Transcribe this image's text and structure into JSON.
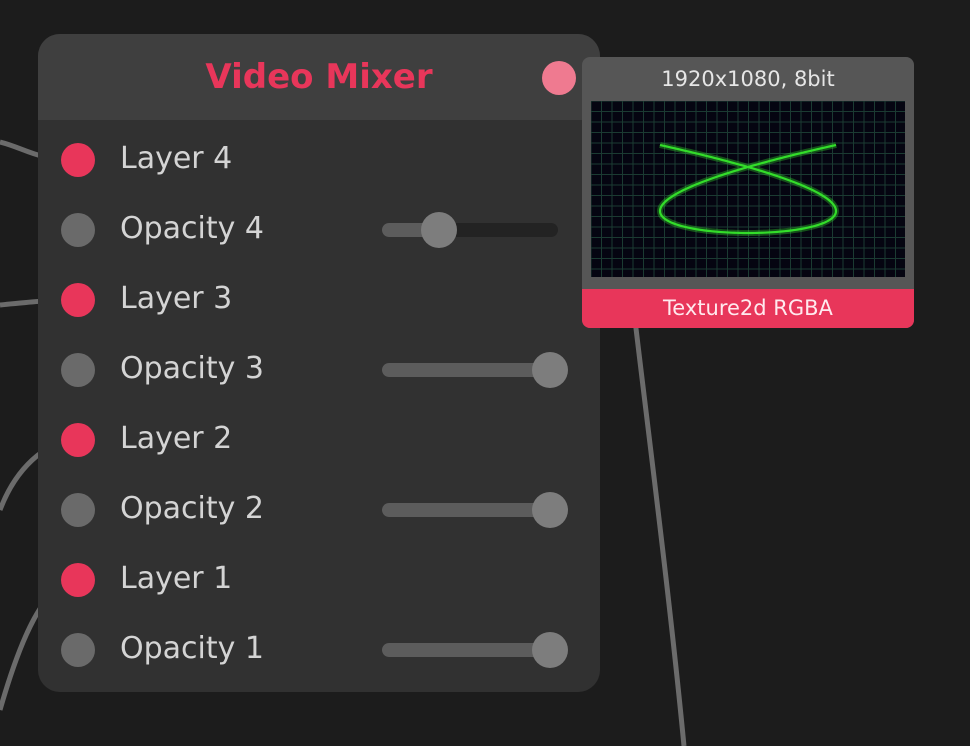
{
  "node": {
    "title": "Video Mixer",
    "rows": [
      {
        "kind": "layer",
        "label": "Layer 4"
      },
      {
        "kind": "opacity",
        "label": "Opacity 4",
        "value": 0.24
      },
      {
        "kind": "layer",
        "label": "Layer 3"
      },
      {
        "kind": "opacity",
        "label": "Opacity 3",
        "value": 1.0
      },
      {
        "kind": "layer",
        "label": "Layer 2"
      },
      {
        "kind": "opacity",
        "label": "Opacity 2",
        "value": 1.0
      },
      {
        "kind": "layer",
        "label": "Layer 1"
      },
      {
        "kind": "opacity",
        "label": "Opacity 1",
        "value": 1.0
      }
    ]
  },
  "preview": {
    "info": "1920x1080, 8bit",
    "type": "Texture2d RGBA"
  },
  "colors": {
    "accent": "#e8365a",
    "background": "#1c1c1c",
    "node_body": "#313131",
    "node_header": "#3f3f3f",
    "lissajous": "#33dd2a"
  },
  "icons": {
    "layer_port": "red-dot",
    "opacity_port": "gray-dot",
    "output_port": "pink-dot"
  }
}
